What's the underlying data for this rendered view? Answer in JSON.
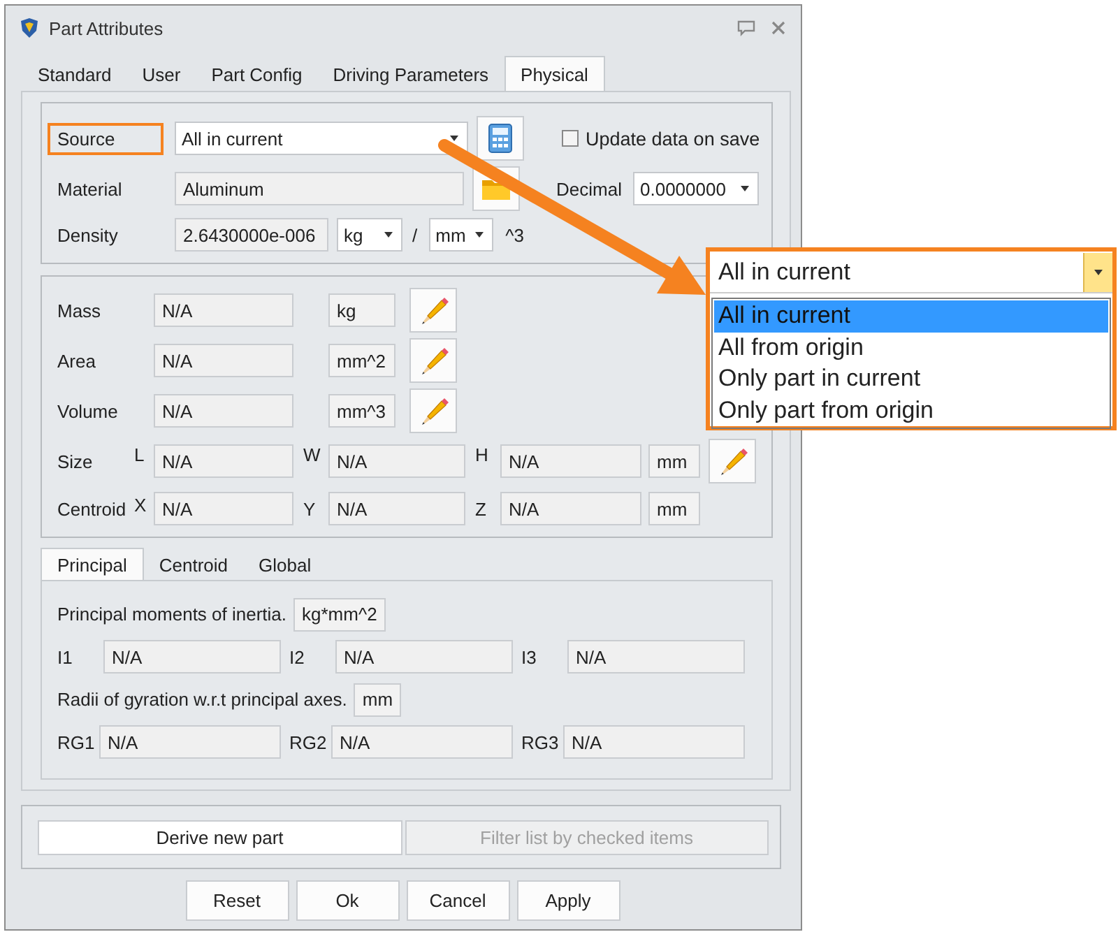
{
  "window": {
    "title": "Part Attributes"
  },
  "tabs": [
    {
      "label": "Standard",
      "selected": false
    },
    {
      "label": "User",
      "selected": false
    },
    {
      "label": "Part Config",
      "selected": false
    },
    {
      "label": "Driving Parameters",
      "selected": false
    },
    {
      "label": "Physical",
      "selected": true
    }
  ],
  "source": {
    "label": "Source",
    "highlighted": true,
    "value": "All in current"
  },
  "update_on_save": {
    "label": "Update data on save",
    "checked": false
  },
  "material": {
    "label": "Material",
    "value": "Aluminum"
  },
  "decimal": {
    "label": "Decimal",
    "value": "0.0000000"
  },
  "density": {
    "label": "Density",
    "value": "2.6430000e-006",
    "mass_unit": "kg",
    "separator": "/",
    "length_unit": "mm",
    "exponent": "^3"
  },
  "properties": [
    {
      "label": "Mass",
      "value": "N/A",
      "unit": "kg"
    },
    {
      "label": "Area",
      "value": "N/A",
      "unit": "mm^2"
    },
    {
      "label": "Volume",
      "value": "N/A",
      "unit": "mm^3"
    }
  ],
  "size": {
    "label": "Size",
    "axes": [
      {
        "axis": "L",
        "value": "N/A"
      },
      {
        "axis": "W",
        "value": "N/A"
      },
      {
        "axis": "H",
        "value": "N/A"
      }
    ],
    "unit": "mm"
  },
  "centroid": {
    "label": "Centroid",
    "axes": [
      {
        "axis": "X",
        "value": "N/A"
      },
      {
        "axis": "Y",
        "value": "N/A"
      },
      {
        "axis": "Z",
        "value": "N/A"
      }
    ],
    "unit": "mm"
  },
  "inertia_tabs": [
    {
      "label": "Principal",
      "selected": true
    },
    {
      "label": "Centroid",
      "selected": false
    },
    {
      "label": "Global",
      "selected": false
    }
  ],
  "principal": {
    "moments_label": "Principal moments of inertia.",
    "moments_unit": "kg*mm^2",
    "moments": [
      {
        "label": "I1",
        "value": "N/A"
      },
      {
        "label": "I2",
        "value": "N/A"
      },
      {
        "label": "I3",
        "value": "N/A"
      }
    ],
    "radii_label": "Radii of gyration w.r.t principal axes.",
    "radii_unit": "mm",
    "radii": [
      {
        "label": "RG1",
        "value": "N/A"
      },
      {
        "label": "RG2",
        "value": "N/A"
      },
      {
        "label": "RG3",
        "value": "N/A"
      }
    ]
  },
  "actions": [
    {
      "label": "Derive new part",
      "disabled": false
    },
    {
      "label": "Filter list by checked items",
      "disabled": true
    }
  ],
  "buttons": [
    "Reset",
    "Ok",
    "Cancel",
    "Apply"
  ],
  "callout": {
    "value": "All in current",
    "options": [
      {
        "label": "All in current",
        "selected": true
      },
      {
        "label": "All from origin",
        "selected": false
      },
      {
        "label": "Only part in current",
        "selected": false
      },
      {
        "label": "Only part from origin",
        "selected": false
      }
    ]
  }
}
